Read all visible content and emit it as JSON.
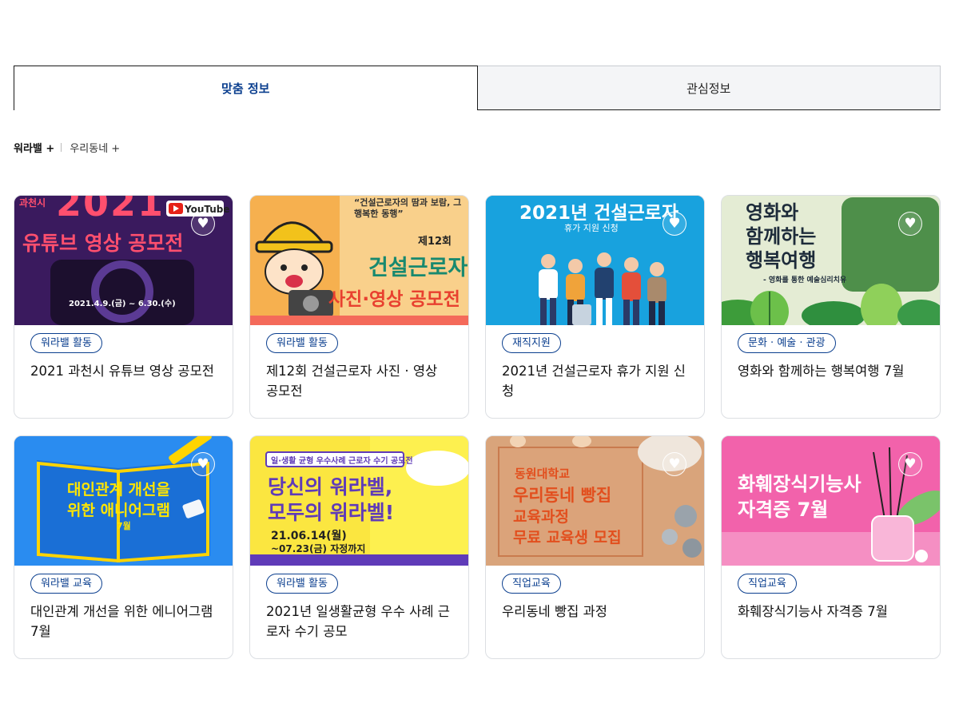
{
  "tabs": [
    {
      "label": "맞춤 정보",
      "active": true
    },
    {
      "label": "관심정보",
      "active": false
    }
  ],
  "filters": [
    {
      "label": "워라밸 +",
      "active": true
    },
    {
      "label": "우리동네 +",
      "active": false
    }
  ],
  "heart_icon": "♥",
  "colors": {
    "accent": "#0b3f8f"
  },
  "cards": [
    {
      "tag": "워라밸 활동",
      "title": "2021 과천시 유튜브 영상 공모전",
      "thumb": {
        "line1": "과천시",
        "line2": "2021",
        "line3": "유튜브 영상 공모전",
        "date": "2021.4.9.(금) ~ 6.30.(수)",
        "brand": "YouTube"
      }
    },
    {
      "tag": "워라밸 활동",
      "title": "제12회 건설근로자 사진 · 영상 공모전",
      "thumb": {
        "quote": "“건설근로자의 땀과 보람, 그 행복한 동행”",
        "line1": "제12회",
        "line2": "건설근로자",
        "line3": "사진·영상 공모전"
      }
    },
    {
      "tag": "재직지원",
      "title": "2021년 건설근로자 휴가 지원 신청",
      "thumb": {
        "line1": "2021년 건설근로자",
        "line2": "휴가 지원 신청"
      }
    },
    {
      "tag": "문화 · 예술 · 관광",
      "title": "영화와 함께하는 행복여행 7월",
      "thumb": {
        "line1": "영화와",
        "line2": "함께하는",
        "line3": "행복여행",
        "sub": "- 영화를 통한 예술심리치유"
      }
    },
    {
      "tag": "워라밸 교육",
      "title": "대인관계 개선을 위한 에니어그램 7월",
      "thumb": {
        "line1": "대인관계 개선을",
        "line2": "위한 애니어그램",
        "line3": "7월"
      }
    },
    {
      "tag": "워라밸 활동",
      "title": "2021년 일생활균형 우수 사례 근로자 수기 공모",
      "thumb": {
        "banner": "일·생활 균형 우수사례 근로자 수기 공모전",
        "line1": "당신의 워라벨,",
        "line2": "모두의 워라벨!",
        "date1": "21.06.14(월)",
        "date2": "~07.23(금) 자정까지"
      }
    },
    {
      "tag": "직업교육",
      "title": "우리동네 빵집 과정",
      "thumb": {
        "line1": "동원대학교",
        "line2": "우리동네 빵집",
        "line3": "교육과정",
        "line4": "무료 교육생 모집"
      }
    },
    {
      "tag": "직업교육",
      "title": "화훼장식기능사 자격증 7월",
      "thumb": {
        "line1": "화훼장식기능사",
        "line2": "자격증 7월"
      }
    }
  ]
}
